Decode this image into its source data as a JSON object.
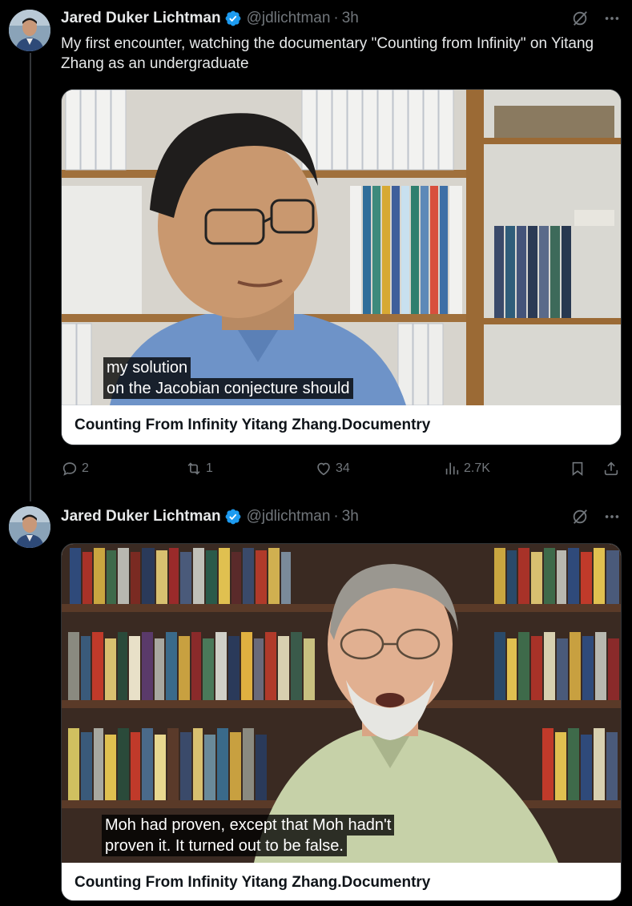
{
  "tweets": [
    {
      "author": "Jared Duker Lichtman",
      "handle": "@jdlichtman",
      "separator": "·",
      "time": "3h",
      "text": "My first encounter, watching the documentary \"Counting from Infinity\" on Yitang Zhang as an undergraduate",
      "card": {
        "subtitle_line1": "my solution",
        "subtitle_line2": "on the Jacobian conjecture should",
        "title": "Counting From Infinity Yitang Zhang.Documentry"
      },
      "stats": {
        "replies": "2",
        "reposts": "1",
        "likes": "34",
        "views": "2.7K"
      }
    },
    {
      "author": "Jared Duker Lichtman",
      "handle": "@jdlichtman",
      "separator": "·",
      "time": "3h",
      "card": {
        "subtitle_line1": "Moh had proven, except that Moh hadn't",
        "subtitle_line2": "proven it. It turned out to be false.",
        "title": "Counting From Infinity Yitang Zhang.Documentry"
      }
    }
  ],
  "colors": {
    "background": "#000000",
    "text": "#e7e9ea",
    "secondary": "#71767b",
    "verified": "#1d9bf0",
    "card_title_bg": "#ffffff"
  },
  "icons": [
    "grok-icon",
    "more-icon",
    "verified-icon",
    "reply-icon",
    "repost-icon",
    "like-icon",
    "views-icon",
    "bookmark-icon",
    "share-icon"
  ]
}
